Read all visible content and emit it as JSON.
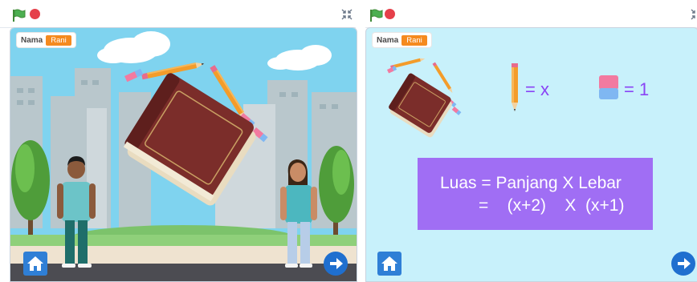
{
  "left_panel": {
    "player_label": "Nama",
    "player_name": "Rani"
  },
  "right_panel": {
    "player_label": "Nama",
    "player_name": "Rani",
    "legend": {
      "pencil_value": "= x",
      "eraser_value": "= 1"
    },
    "formula": {
      "line1": "Luas = Panjang X Lebar",
      "line2": "=    (x+2)    X  (x+1)"
    }
  },
  "icons": {
    "green_flag": "green-flag-icon",
    "stop": "stop-icon",
    "fullscreen": "fullscreen-icon",
    "home": "home-icon",
    "next": "arrow-right-icon"
  },
  "colors": {
    "flag_green": "#4caf50",
    "stop_red": "#e5404a",
    "name_badge": "#f58a1f",
    "right_stage_bg": "#c8f1fb",
    "formula_bg": "#a06ef4",
    "legend_purple": "#8a44f5",
    "button_blue": "#2f7fd6"
  }
}
